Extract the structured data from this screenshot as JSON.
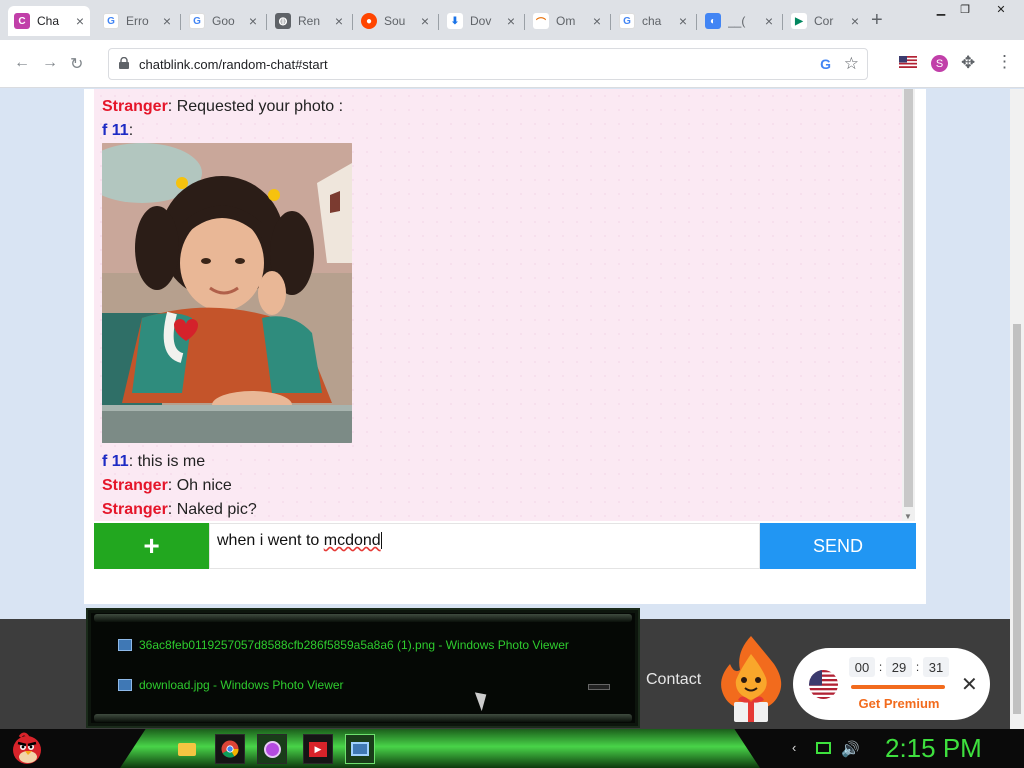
{
  "browser": {
    "tabs": [
      {
        "label": "Cha",
        "favicon": "chatblink-icon",
        "color": "#c13fa9",
        "glyph": "C",
        "active": true
      },
      {
        "label": "Erro",
        "favicon": "google-icon",
        "color": "#4285f4",
        "glyph": "G"
      },
      {
        "label": "Goo",
        "favicon": "google-icon",
        "color": "#4285f4",
        "glyph": "G"
      },
      {
        "label": "Ren",
        "favicon": "globe-icon",
        "color": "#5f6368",
        "glyph": "◍"
      },
      {
        "label": "Sou",
        "favicon": "reddit-icon",
        "color": "#ff4500",
        "glyph": "●"
      },
      {
        "label": "Dov",
        "favicon": "download-icon",
        "color": "#1a73e8",
        "glyph": "⬇"
      },
      {
        "label": "Om",
        "favicon": "rainbow-icon",
        "color": "#e8710a",
        "glyph": "⌒"
      },
      {
        "label": "cha",
        "favicon": "google-icon",
        "color": "#4285f4",
        "glyph": "G"
      },
      {
        "label": "__(",
        "favicon": "google-lens-icon",
        "color": "#4285f4",
        "glyph": "◐"
      },
      {
        "label": "Cor",
        "favicon": "play-store-icon",
        "color": "#01875f",
        "glyph": "▶"
      }
    ],
    "url": "chatblink.com/random-chat#start"
  },
  "chat": {
    "messages": [
      {
        "who": "Stranger",
        "text": ": Requested your photo :",
        "kind": "stranger"
      },
      {
        "who": "f 11",
        "text": ":",
        "kind": "self"
      },
      {
        "who": "f 11",
        "text": ": this is me",
        "kind": "self"
      },
      {
        "who": "Stranger",
        "text": ": Oh nice",
        "kind": "stranger"
      },
      {
        "who": "Stranger",
        "text": ": Naked pic?",
        "kind": "stranger"
      }
    ],
    "input_value_plain": "when i went to ",
    "input_value_misspelled": "mcdond",
    "plus_label": "+",
    "send_label": "SEND"
  },
  "footer": {
    "contact_label": "Contact",
    "timer": {
      "hh": "00",
      "mm": "29",
      "ss": "31"
    },
    "premium_label": "Get Premium",
    "close_glyph": "✕"
  },
  "flyout": {
    "items": [
      "36ac8feb0119257057d8588cfb286f5859a5a8a6 (1).png - Windows Photo Viewer",
      "download.jpg - Windows Photo Viewer"
    ]
  },
  "taskbar": {
    "time": "2:15 PM"
  },
  "colors": {
    "stranger": "#e5162a",
    "self": "#1d2bc4",
    "plus_button": "#22a71f",
    "send_button": "#2196f3",
    "premium_accent": "#f26b1d",
    "clock": "#3ee03e"
  }
}
